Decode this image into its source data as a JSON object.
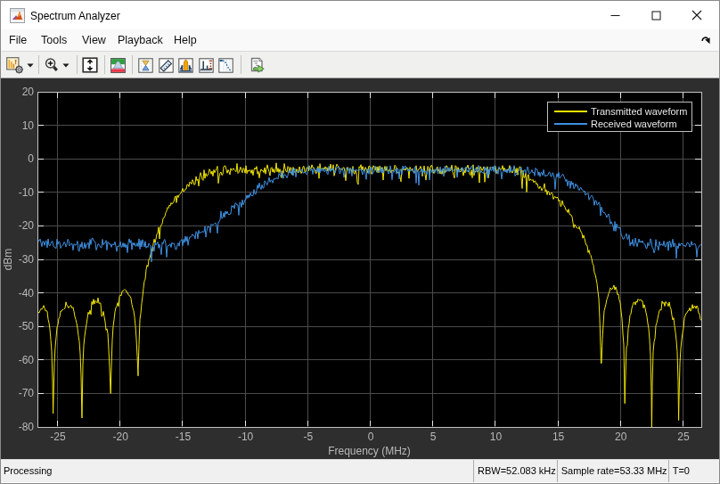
{
  "window": {
    "title": "Spectrum Analyzer",
    "controls": {
      "minimize": "minimize",
      "maximize": "maximize",
      "close": "close"
    }
  },
  "menu": {
    "items": [
      {
        "label": "File",
        "x": 9
      },
      {
        "label": "Tools",
        "x": 45
      },
      {
        "label": "View",
        "x": 91
      },
      {
        "label": "Playback",
        "x": 131
      },
      {
        "label": "Help",
        "x": 194
      }
    ]
  },
  "toolbar": {
    "buttons": [
      {
        "name": "spectrum-settings",
        "dropdown": true
      },
      {
        "name": "zoom-in",
        "dropdown": true
      },
      {
        "name": "scale-y-axis",
        "dropdown": false
      },
      {
        "name": "spectral-mask",
        "dropdown": false
      },
      {
        "name": "cursor-measurements",
        "dropdown": false
      },
      {
        "name": "signal-statistics",
        "dropdown": false
      },
      {
        "name": "peak-finder",
        "dropdown": false
      },
      {
        "name": "distortion-measurements",
        "dropdown": false
      },
      {
        "name": "ccdf-measurements",
        "dropdown": false
      },
      {
        "name": "export",
        "dropdown": false
      }
    ]
  },
  "chart_data": {
    "type": "line",
    "xlabel": "Frequency (MHz)",
    "ylabel": "dBm",
    "xlim": [
      -26.6,
      26.46
    ],
    "ylim": [
      -80,
      20
    ],
    "x_ticks": [
      -25,
      -20,
      -15,
      -10,
      -5,
      0,
      5,
      10,
      15,
      20,
      25
    ],
    "y_ticks": [
      20,
      10,
      0,
      -10,
      -20,
      -30,
      -40,
      -50,
      -60,
      -70,
      -80
    ],
    "grid": true,
    "legend_position": "top-right",
    "plot_bg": "#000000",
    "figure_bg": "#2e2e2e",
    "grid_color": "#4b4b4b",
    "box_color": "#c3c3c3",
    "tick_color": "#e8e8e8",
    "label_color": "#b9b9b9",
    "series": [
      {
        "name": "Transmitted waveform",
        "color": "#f0e500",
        "seed": 20231,
        "flat_level_dBm": -3.2,
        "lobes_left": {
          "nulls": [
            -27.05,
            -25.35,
            -23.05,
            -20.75,
            -18.55
          ],
          "peaks": [
            -44,
            -43.5,
            -42.5,
            -39.5
          ],
          "depths": [
            -48,
            -76,
            -77,
            -70,
            -63
          ]
        },
        "lobes_right": {
          "nulls": [
            18.45,
            20.35,
            22.5,
            24.65,
            26.95
          ],
          "peaks": [
            -38.5,
            -42,
            -43,
            -44
          ],
          "depths": [
            -61,
            -73,
            -81,
            -78,
            -52
          ]
        },
        "envelope": [
          [
            -18.55,
            -63
          ],
          [
            -18.45,
            -50
          ],
          [
            -18.3,
            -44
          ],
          [
            -18.1,
            -38.5
          ],
          [
            -17.9,
            -32.5
          ],
          [
            -17.6,
            -28.8
          ],
          [
            -17.3,
            -25.2
          ],
          [
            -16.8,
            -20.0
          ],
          [
            -16.4,
            -16.9
          ],
          [
            -16.0,
            -14.3
          ],
          [
            -15.5,
            -11.6
          ],
          [
            -15.1,
            -10.0
          ],
          [
            -14.7,
            -8.6
          ],
          [
            -14.3,
            -7.2
          ],
          [
            -13.9,
            -6.1
          ],
          [
            -13.4,
            -5.1
          ],
          [
            -12.9,
            -4.3
          ],
          [
            -12.3,
            -3.7
          ],
          [
            -11.8,
            -3.4
          ],
          [
            -11.2,
            -3.2
          ],
          [
            11.7,
            -3.3
          ],
          [
            12.2,
            -4.4
          ],
          [
            12.8,
            -6.1
          ],
          [
            13.5,
            -8.0
          ],
          [
            14.2,
            -9.4
          ],
          [
            15.0,
            -11.9
          ],
          [
            15.7,
            -15.3
          ],
          [
            16.4,
            -19.4
          ],
          [
            17.0,
            -23.2
          ],
          [
            17.4,
            -26.3
          ],
          [
            17.8,
            -31.0
          ],
          [
            18.1,
            -36.5
          ],
          [
            18.3,
            -43
          ],
          [
            18.45,
            -61
          ]
        ],
        "noise_amp": [
          [
            -26.6,
            0.72
          ],
          [
            -18.6,
            0.72
          ],
          [
            -18.0,
            0.62
          ],
          [
            -14.0,
            0.95
          ],
          [
            -12.0,
            1.05
          ],
          [
            12.0,
            1.05
          ],
          [
            14.0,
            0.95
          ],
          [
            18.0,
            0.62
          ],
          [
            18.6,
            0.72
          ],
          [
            26.46,
            0.72
          ]
        ]
      },
      {
        "name": "Received waveform",
        "color": "#3f90e2",
        "seed": 77017,
        "flat_level_dBm": -3.4,
        "noise_floor_dBm": -25.6,
        "envelope": [
          [
            -26.6,
            -24.8
          ],
          [
            -26.2,
            -25.4
          ],
          [
            -25.0,
            -25.6
          ],
          [
            -15.6,
            -25.6
          ],
          [
            -15.0,
            -24.8
          ],
          [
            -14.5,
            -24.0
          ],
          [
            -13.6,
            -22.2
          ],
          [
            -12.7,
            -20.1
          ],
          [
            -11.8,
            -17.4
          ],
          [
            -10.9,
            -14.3
          ],
          [
            -9.9,
            -11.9
          ],
          [
            -9.0,
            -9.1
          ],
          [
            -8.2,
            -6.9
          ],
          [
            -7.4,
            -5.3
          ],
          [
            -6.6,
            -4.3
          ],
          [
            -5.8,
            -3.8
          ],
          [
            -5.0,
            -3.5
          ],
          [
            12.9,
            -3.5
          ],
          [
            13.6,
            -4.2
          ],
          [
            14.3,
            -5.0
          ],
          [
            15.2,
            -5.7
          ],
          [
            16.3,
            -8.1
          ],
          [
            17.4,
            -10.5
          ],
          [
            18.2,
            -13.6
          ],
          [
            18.8,
            -16.4
          ],
          [
            19.4,
            -19.2
          ],
          [
            20.0,
            -21.8
          ],
          [
            20.6,
            -23.8
          ],
          [
            21.2,
            -25.1
          ],
          [
            22.0,
            -25.6
          ],
          [
            26.0,
            -25.6
          ],
          [
            26.46,
            -25.0
          ]
        ],
        "noise_amp": [
          [
            -26.6,
            1.15
          ],
          [
            -15.5,
            1.15
          ],
          [
            -12.0,
            1.0
          ],
          [
            -6.0,
            0.85
          ],
          [
            12.5,
            0.85
          ],
          [
            16.0,
            0.9
          ],
          [
            19.5,
            1.0
          ],
          [
            26.46,
            1.15
          ]
        ]
      }
    ],
    "rbw_khz": 52.083,
    "sample_rate_mhz": 53.33
  },
  "status_bar": {
    "left": "Processing",
    "segments": [
      "RBW=52.083 kHz",
      "Sample rate=53.33 MHz",
      "T=0"
    ]
  }
}
